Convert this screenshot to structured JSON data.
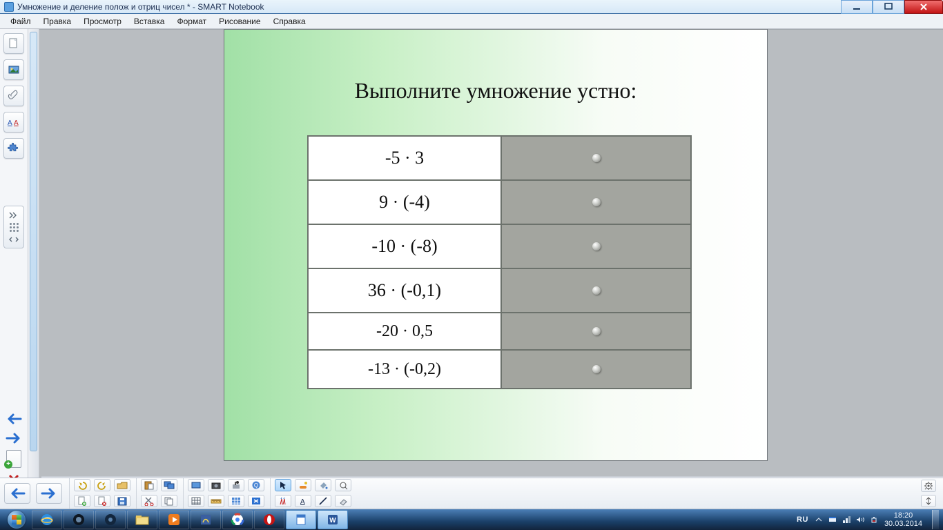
{
  "window": {
    "title": "Умножение и деление полож и отриц чисел * - SMART Notebook"
  },
  "menu": [
    "Файл",
    "Правка",
    "Просмотр",
    "Вставка",
    "Формат",
    "Рисование",
    "Справка"
  ],
  "slide": {
    "heading": "Выполните умножение устно:",
    "rows": [
      "-5 · 3",
      "9 · (-4)",
      "-10 · (-8)",
      "36 · (-0,1)",
      "-20 · 0,5",
      "-13 · (-0,2)"
    ]
  },
  "tray": {
    "lang": "RU",
    "time": "18:20",
    "date": "30.03.2014"
  }
}
